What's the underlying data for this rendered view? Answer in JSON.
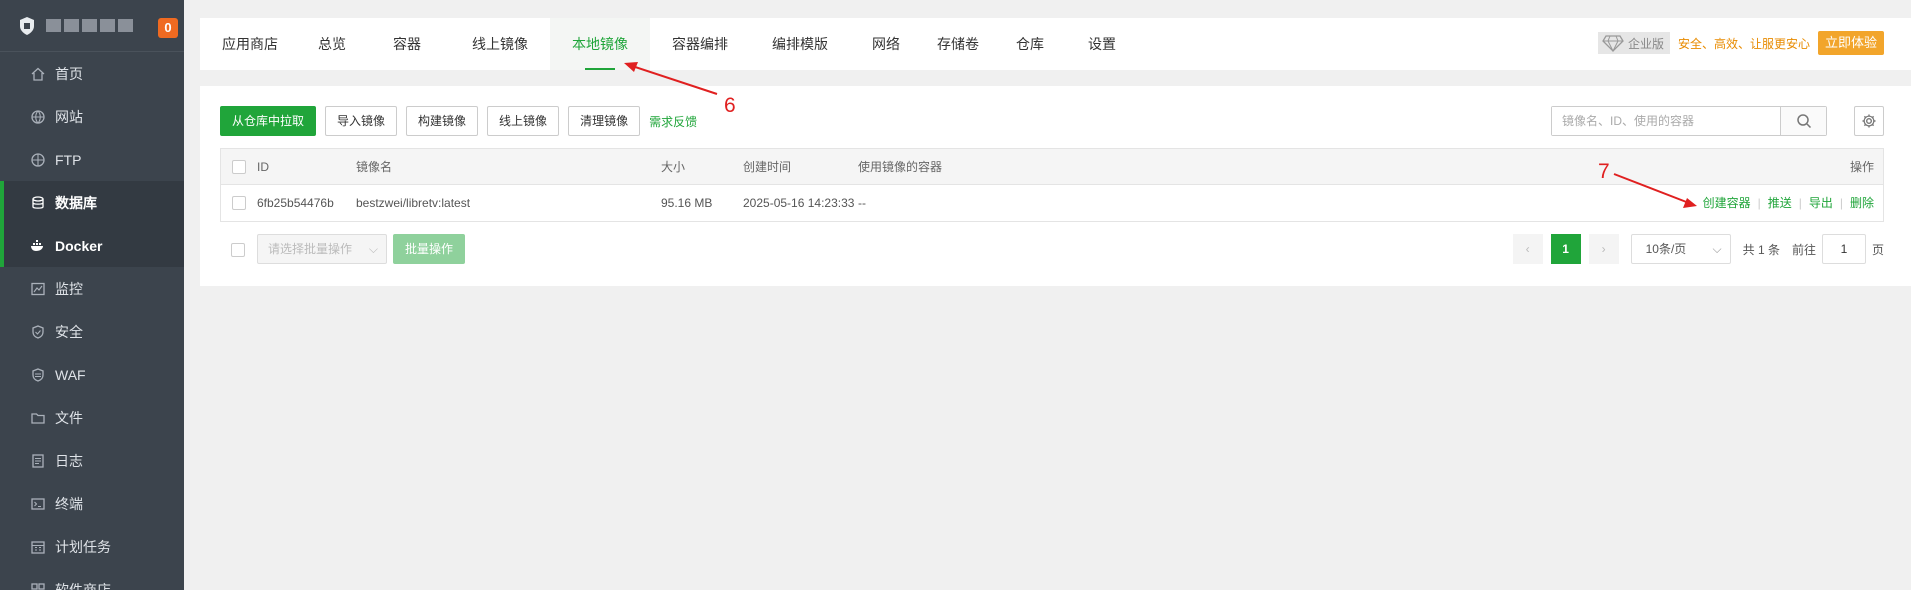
{
  "sidebar": {
    "badge": "0",
    "items": [
      {
        "label": "首页",
        "icon": "home-icon"
      },
      {
        "label": "网站",
        "icon": "globe-icon"
      },
      {
        "label": "FTP",
        "icon": "ftp-icon"
      },
      {
        "label": "数据库",
        "icon": "database-icon"
      },
      {
        "label": "Docker",
        "icon": "docker-icon"
      },
      {
        "label": "监控",
        "icon": "monitor-icon"
      },
      {
        "label": "安全",
        "icon": "shield-icon"
      },
      {
        "label": "WAF",
        "icon": "waf-icon"
      },
      {
        "label": "文件",
        "icon": "folder-icon"
      },
      {
        "label": "日志",
        "icon": "log-icon"
      },
      {
        "label": "终端",
        "icon": "terminal-icon"
      },
      {
        "label": "计划任务",
        "icon": "calendar-icon"
      },
      {
        "label": "软件商店",
        "icon": "store-icon"
      }
    ]
  },
  "tabs": [
    "应用商店",
    "总览",
    "容器",
    "线上镜像",
    "本地镜像",
    "容器编排",
    "编排模版",
    "网络",
    "存储卷",
    "仓库",
    "设置"
  ],
  "active_tab": "本地镜像",
  "promo": {
    "badge": "企业版",
    "text": "安全、高效、让服更安心",
    "button": "立即体验"
  },
  "toolbar": {
    "pull": "从仓库中拉取",
    "import": "导入镜像",
    "build": "构建镜像",
    "online": "线上镜像",
    "clean": "清理镜像",
    "feedback": "需求反馈"
  },
  "search": {
    "placeholder": "镜像名、ID、使用的容器"
  },
  "table": {
    "headers": {
      "id": "ID",
      "name": "镜像名",
      "size": "大小",
      "created": "创建时间",
      "containers": "使用镜像的容器",
      "actions": "操作"
    },
    "rows": [
      {
        "id": "6fb25b54476b",
        "name": "bestzwei/libretv:latest",
        "size": "95.16 MB",
        "created": "2025-05-16 14:23:33",
        "containers": "--",
        "actions": [
          "创建容器",
          "推送",
          "导出",
          "删除"
        ]
      }
    ]
  },
  "footer": {
    "batch_placeholder": "请选择批量操作",
    "batch_button": "批量操作"
  },
  "pagination": {
    "current": "1",
    "page_size": "10条/页",
    "total": "共 1 条",
    "goto_label": "前往",
    "goto_value": "1",
    "page_suffix": "页"
  },
  "annotations": [
    "6",
    "7"
  ],
  "colors": {
    "brand_green": "#20a53a",
    "sidebar_bg": "#3c444d",
    "annotation_red": "#e02020",
    "promo_orange": "#f2a52b"
  }
}
